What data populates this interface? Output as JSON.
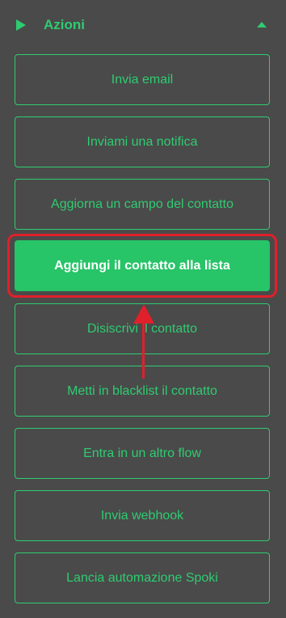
{
  "header": {
    "title": "Azioni",
    "left_icon": "play-icon",
    "right_icon": "chevron-up-icon"
  },
  "actions": [
    {
      "label": "Invia email"
    },
    {
      "label": "Inviami una notifica"
    },
    {
      "label": "Aggiorna un campo del contatto"
    },
    {
      "label": "Aggiungi il contatto alla lista",
      "active": true
    },
    {
      "label": "Disiscrivi il contatto"
    },
    {
      "label": "Metti in blacklist il contatto"
    },
    {
      "label": "Entra in un altro flow"
    },
    {
      "label": "Invia webhook"
    },
    {
      "label": "Lancia automazione Spoki"
    }
  ],
  "colors": {
    "background": "#4a4a4a",
    "accent": "#2ecc71",
    "active_fill": "#27c468",
    "annotation": "#e0202a"
  }
}
